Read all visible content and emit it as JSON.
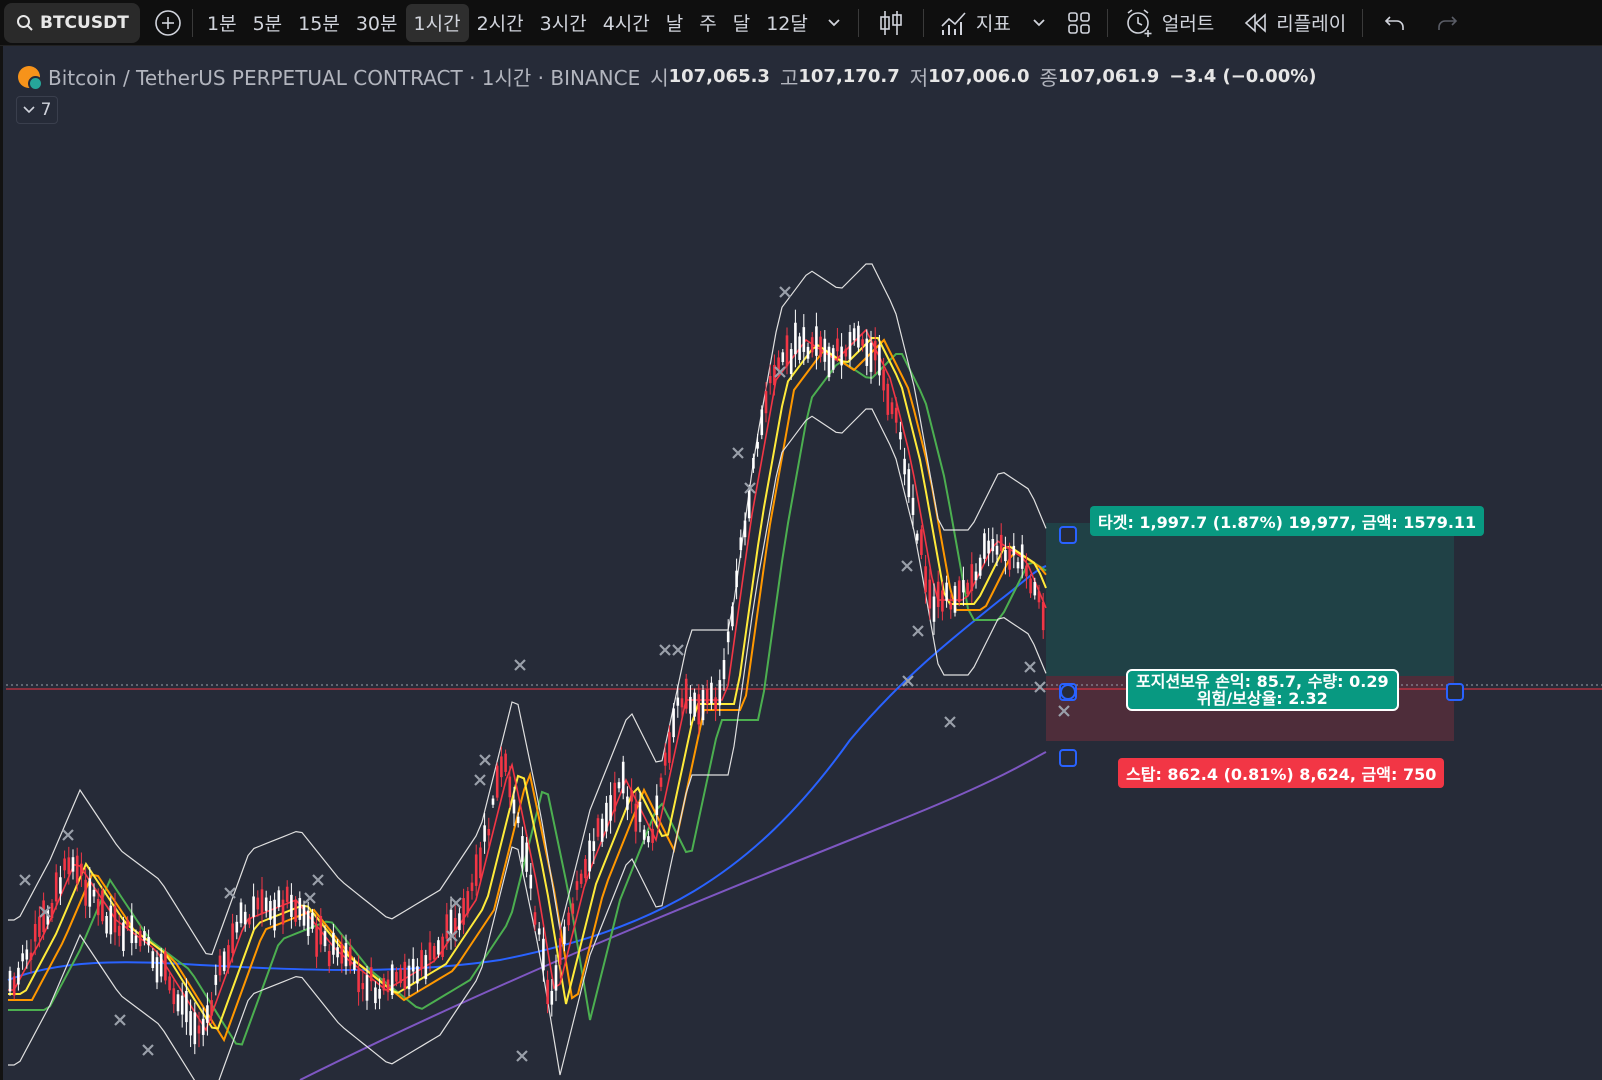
{
  "toolbar": {
    "symbol": "BTCUSDT",
    "timeframes": [
      "1분",
      "5분",
      "15분",
      "30분",
      "1시간",
      "2시간",
      "3시간",
      "4시간",
      "날",
      "주",
      "달",
      "12달"
    ],
    "active_timeframe": "1시간",
    "indicators_label": "지표",
    "alert_label": "얼러트",
    "replay_label": "리플레이"
  },
  "legend": {
    "pair": "Bitcoin / TetherUS PERPETUAL CONTRACT · 1시간 · BINANCE",
    "open_label": "시",
    "open": "107,065.3",
    "high_label": "고",
    "high": "107,170.7",
    "low_label": "저",
    "low": "107,006.0",
    "close_label": "종",
    "close": "107,061.9",
    "change": "−3.4 (−0.00%)",
    "indicator_count": "7"
  },
  "position_tool": {
    "target_text": "타겟: 1,997.7 (1.87%) 19,977, 금액: 1579.11",
    "position_line1": "포지션보유 손익: 85.7, 수량: 0.29",
    "position_line2": "위험/보상율: 2.32",
    "stop_text": "스탑: 862.4 (0.81%) 8,624, 금액: 750",
    "target_color": "#089981",
    "stop_color": "#f23645"
  },
  "colors": {
    "background": "#262b38",
    "up_candle": "#ffffff",
    "down_candle": "#f23645",
    "ma_red": "#f23645",
    "ma_orange": "#ff9800",
    "ma_yellow": "#ffeb3b",
    "ma_green": "#4caf50",
    "ma_blue": "#2962ff",
    "ma_purple": "#7e57c2",
    "bollinger": "#e0e0e0"
  }
}
